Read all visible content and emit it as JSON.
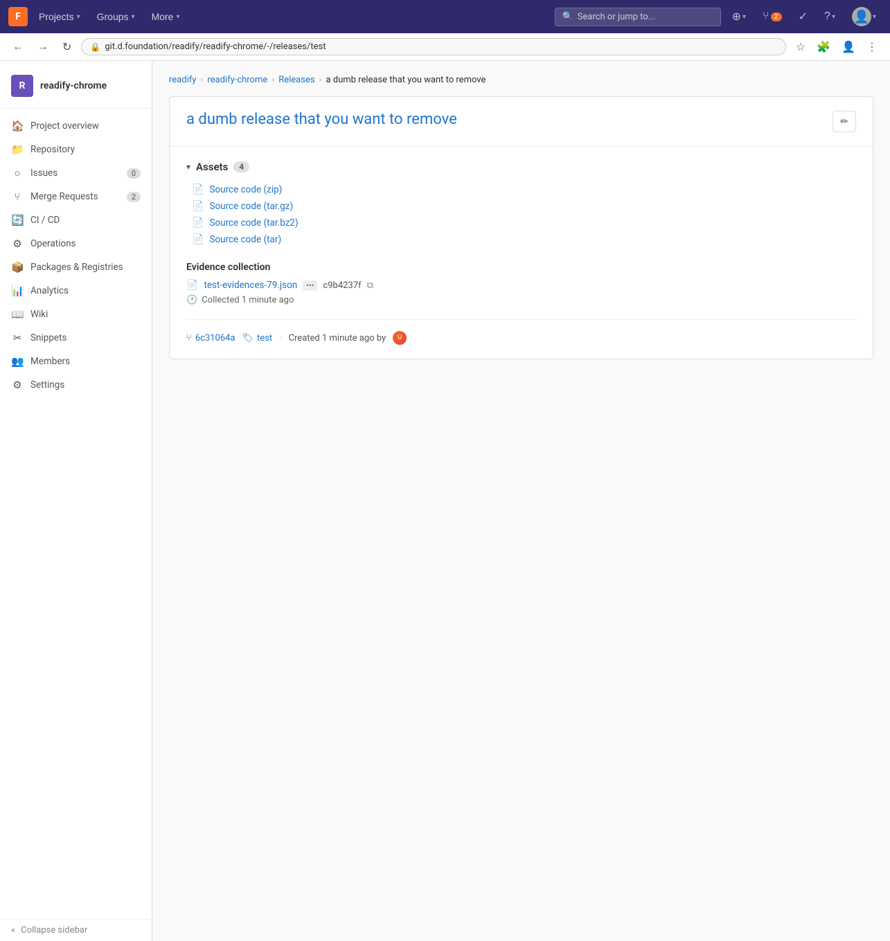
{
  "browser": {
    "url": "git.d.foundation/readify/readify-chrome/-/releases/test",
    "back_title": "Back",
    "forward_title": "Forward",
    "reload_title": "Reload"
  },
  "topnav": {
    "logo": "F",
    "projects_label": "Projects",
    "groups_label": "Groups",
    "more_label": "More",
    "search_placeholder": "Search or jump to...",
    "new_icon": "+",
    "mr_count": "2",
    "todo_icon": "✓",
    "help_label": "?",
    "avatar_label": "U"
  },
  "sidebar": {
    "project_name": "readify-chrome",
    "avatar_letter": "R",
    "collapse_label": "Collapse sidebar",
    "items": [
      {
        "id": "project-overview",
        "label": "Project overview",
        "icon": "🏠",
        "badge": null
      },
      {
        "id": "repository",
        "label": "Repository",
        "icon": "📁",
        "badge": null
      },
      {
        "id": "issues",
        "label": "Issues",
        "icon": "○",
        "badge": "0"
      },
      {
        "id": "merge-requests",
        "label": "Merge Requests",
        "icon": "⑂",
        "badge": "2"
      },
      {
        "id": "ci-cd",
        "label": "CI / CD",
        "icon": "🔄",
        "badge": null
      },
      {
        "id": "operations",
        "label": "Operations",
        "icon": "⚙",
        "badge": null
      },
      {
        "id": "packages-registries",
        "label": "Packages & Registries",
        "icon": "📦",
        "badge": null
      },
      {
        "id": "analytics",
        "label": "Analytics",
        "icon": "📊",
        "badge": null
      },
      {
        "id": "wiki",
        "label": "Wiki",
        "icon": "📖",
        "badge": null
      },
      {
        "id": "snippets",
        "label": "Snippets",
        "icon": "✂",
        "badge": null
      },
      {
        "id": "members",
        "label": "Members",
        "icon": "👥",
        "badge": null
      },
      {
        "id": "settings",
        "label": "Settings",
        "icon": "⚙",
        "badge": null
      }
    ]
  },
  "breadcrumb": {
    "items": [
      {
        "label": "readify",
        "href": "#"
      },
      {
        "label": "readify-chrome",
        "href": "#"
      },
      {
        "label": "Releases",
        "href": "#"
      },
      {
        "label": "a dumb release that you want to remove",
        "href": null
      }
    ]
  },
  "release": {
    "title": "a dumb release that you want to remove",
    "edit_tooltip": "Edit release",
    "assets": {
      "label": "Assets",
      "count": "4",
      "items": [
        {
          "label": "Source code (zip)",
          "icon": "📄"
        },
        {
          "label": "Source code (tar.gz)",
          "icon": "📄"
        },
        {
          "label": "Source code (tar.bz2)",
          "icon": "📄"
        },
        {
          "label": "Source code (tar)",
          "icon": "📄"
        }
      ]
    },
    "evidence": {
      "section_title": "Evidence collection",
      "filename": "test-evidences-79.json",
      "dots": "•••",
      "hash": "c9b4237f",
      "collected_label": "Collected 1 minute ago"
    },
    "meta": {
      "commit_hash": "6c31064a",
      "tag": "test",
      "created_text": "Created 1 minute ago by"
    }
  }
}
